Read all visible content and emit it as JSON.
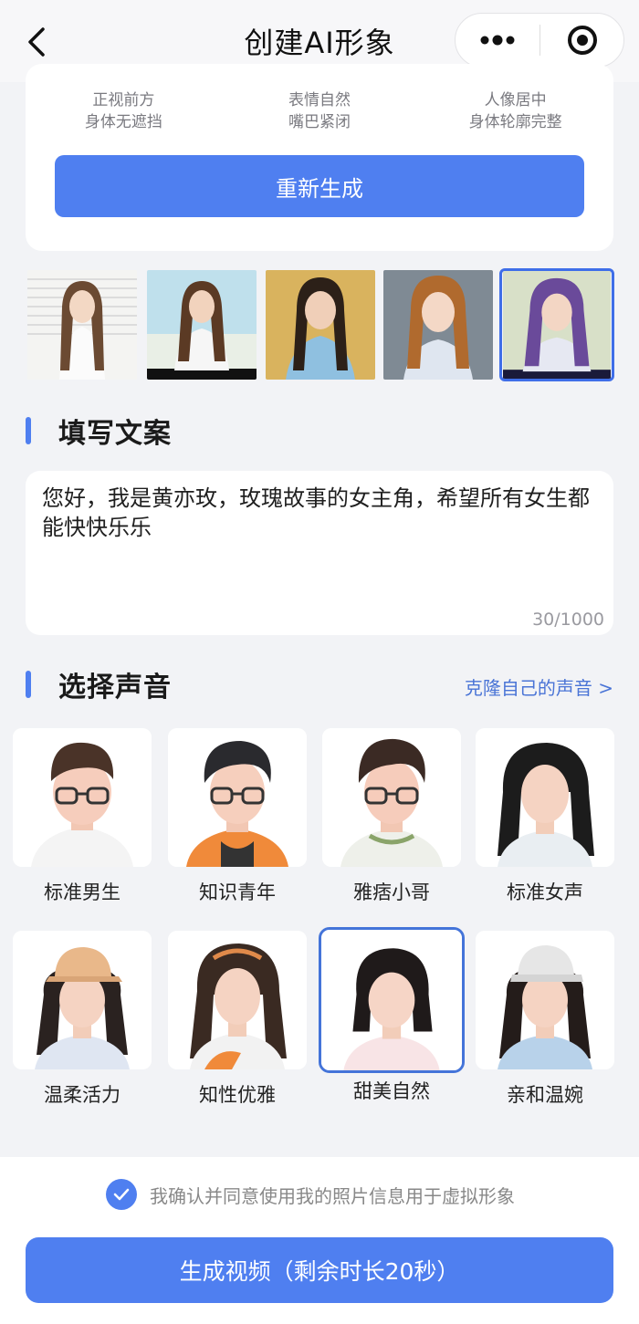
{
  "nav": {
    "title": "创建AI形象",
    "back_icon": "chevron-left-icon",
    "more_icon": "more-dots-icon",
    "close_icon": "target-close-icon"
  },
  "photo_tips": [
    {
      "line1": "正视前方",
      "line2": "身体无遮挡"
    },
    {
      "line1": "表情自然",
      "line2": "嘴巴紧闭"
    },
    {
      "line1": "人像居中",
      "line2": "身体轮廓完整"
    }
  ],
  "regenerate_label": "重新生成",
  "thumbnails": [
    {
      "name": "generated-image-1",
      "selected": false
    },
    {
      "name": "generated-image-2",
      "selected": false
    },
    {
      "name": "generated-image-3",
      "selected": false
    },
    {
      "name": "generated-image-4",
      "selected": false
    },
    {
      "name": "generated-image-5",
      "selected": true
    }
  ],
  "script_section": {
    "title": "填写文案",
    "content": "您好，我是黄亦玫，玫瑰故事的女主角，希望所有女生都能快快乐乐",
    "counter": "30/1000"
  },
  "voice_section": {
    "title": "选择声音",
    "clone_link": "克隆自己的声音 >",
    "voices": [
      {
        "label": "标准男生",
        "selected": false
      },
      {
        "label": "知识青年",
        "selected": false
      },
      {
        "label": "雅痞小哥",
        "selected": false
      },
      {
        "label": "标准女声",
        "selected": false
      },
      {
        "label": "温柔活力",
        "selected": false
      },
      {
        "label": "知性优雅",
        "selected": false
      },
      {
        "label": "甜美自然",
        "selected": true
      },
      {
        "label": "亲和温婉",
        "selected": false
      }
    ]
  },
  "consent": {
    "checked": true,
    "text": "我确认并同意使用我的照片信息用于虚拟形象"
  },
  "generate_button": "生成视频（剩余时长20秒）",
  "colors": {
    "accent": "#4f7ff0",
    "link": "#4a74d6",
    "background": "#f2f3f6"
  }
}
